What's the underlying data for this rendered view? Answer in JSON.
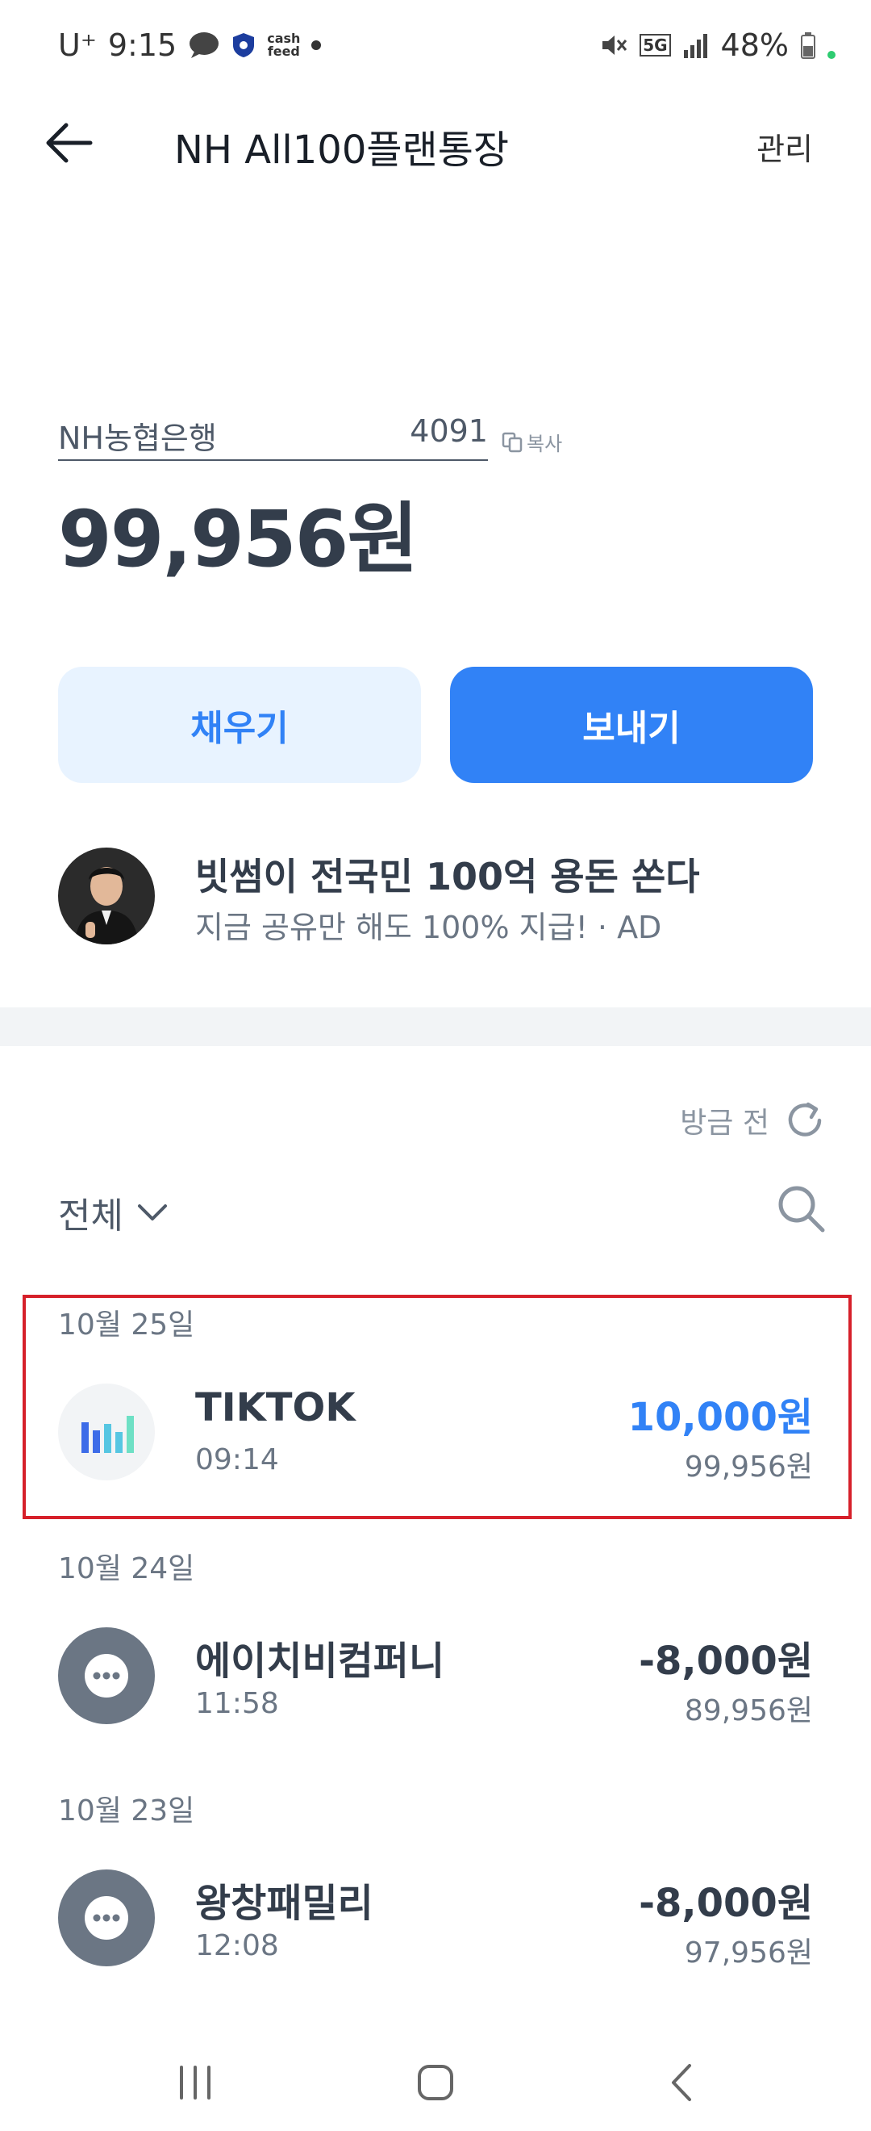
{
  "status_bar": {
    "carrier": "U⁺",
    "time": "9:15",
    "cash_label": "cash\nfeed",
    "network": "5G",
    "battery": "48%"
  },
  "header": {
    "title": "NH All100플랜통장",
    "manage_label": "관리"
  },
  "account": {
    "bank": "NH농협은행",
    "number": "4091",
    "copy_label": "복사",
    "balance": "99,956원"
  },
  "actions": {
    "fill_label": "채우기",
    "send_label": "보내기"
  },
  "ad": {
    "title": "빗썸이 전국민 100억 용돈 쏜다",
    "subtitle": "지금 공유만 해도 100% 지급! · AD"
  },
  "history": {
    "refresh_label": "방금 전",
    "filter_label": "전체",
    "groups": [
      {
        "date": "10월 25일",
        "tx": {
          "name": "TIKTOK",
          "time": "09:14",
          "amount": "10,000원",
          "balance": "99,956원",
          "icon": "bar-chart-icon"
        }
      },
      {
        "date": "10월 24일",
        "tx": {
          "name": "에이치비컴퍼니",
          "time": "11:58",
          "amount": "-8,000원",
          "balance": "89,956원",
          "icon": "more-icon"
        }
      },
      {
        "date": "10월 23일",
        "tx": {
          "name": "왕창패밀리",
          "time": "12:08",
          "amount": "-8,000원",
          "balance": "97,956원",
          "icon": "more-icon"
        }
      }
    ]
  },
  "colors": {
    "accent": "#3182f6",
    "accent_light": "#e8f3ff",
    "highlight": "#d6202a",
    "text_primary": "#333d4b",
    "text_secondary": "#6b7684"
  }
}
